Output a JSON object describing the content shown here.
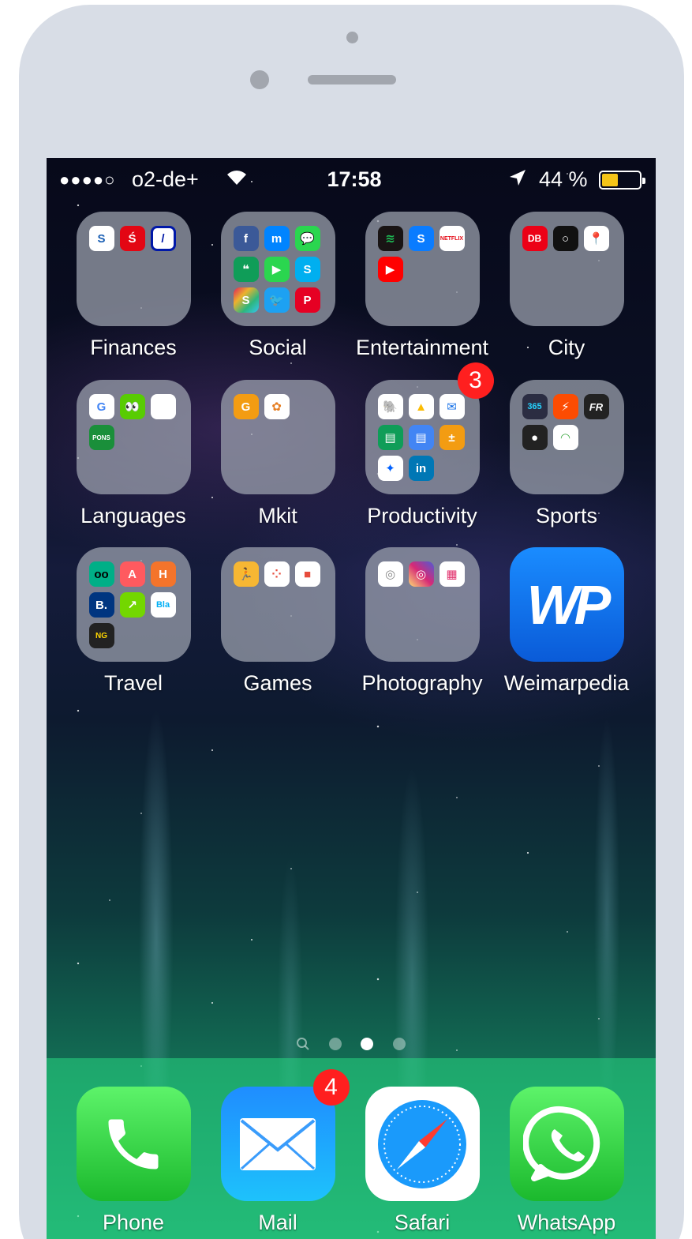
{
  "status_bar": {
    "signal": "●●●●○",
    "carrier": "o2-de+",
    "wifi_icon": "wifi-icon",
    "time": "17:58",
    "location_icon": "location-arrow-icon",
    "battery_percent": "44 %",
    "battery_level": 0.44
  },
  "home": {
    "apps": [
      {
        "label": "Finances",
        "type": "folder"
      },
      {
        "label": "Social",
        "type": "folder"
      },
      {
        "label": "Entertainment",
        "type": "folder"
      },
      {
        "label": "City",
        "type": "folder"
      },
      {
        "label": "Languages",
        "type": "folder"
      },
      {
        "label": "Mkit",
        "type": "folder"
      },
      {
        "label": "Productivity",
        "type": "folder",
        "badge": "3"
      },
      {
        "label": "Sports",
        "type": "folder"
      },
      {
        "label": "Travel",
        "type": "folder"
      },
      {
        "label": "Games",
        "type": "folder"
      },
      {
        "label": "Photography",
        "type": "folder"
      },
      {
        "label": "Weimarpedia",
        "type": "app",
        "icon_text": "WP"
      }
    ],
    "mini_icons": {
      "finances_1": "S",
      "finances_2": "Ś",
      "finances_3": "/",
      "social_1": "f",
      "social_2": "m",
      "social_3": "💬",
      "social_4": "❝",
      "social_5": "▶",
      "social_6": "S",
      "social_7": "S",
      "social_8": "🐦",
      "social_9": "P",
      "ent_1": "≋",
      "ent_2": "S",
      "ent_3": "NETFLIX",
      "ent_4": "▶",
      "city_1": "DB",
      "city_2": "○",
      "city_3": "📍",
      "lang_1": "G",
      "lang_2": "👀",
      "lang_3": "",
      "lang_4": "PONS",
      "mkit_1": "G",
      "mkit_2": "✿",
      "prod_1": "🐘",
      "prod_2": "▲",
      "prod_3": "✉",
      "prod_4": "▤",
      "prod_5": "▤",
      "prod_6": "±",
      "prod_7": "✦",
      "prod_8": "in",
      "sports_1": "365",
      "sports_2": "⚡",
      "sports_3": "FR",
      "sports_4": "●",
      "sports_5": "◠",
      "travel_1": "oo",
      "travel_2": "A",
      "travel_3": "H",
      "travel_4": "B.",
      "travel_5": "↗",
      "travel_6": "Bla",
      "travel_7": "NG",
      "games_1": "🏃",
      "games_2": "⁘",
      "games_3": "■",
      "photo_1": "◎",
      "photo_2": "◎",
      "photo_3": "▦"
    }
  },
  "page_indicator": {
    "search_icon": "search-icon",
    "pages": 3,
    "active_page": 2
  },
  "dock": {
    "apps": [
      {
        "label": "Phone",
        "icon": "phone-icon"
      },
      {
        "label": "Mail",
        "icon": "mail-icon",
        "badge": "4"
      },
      {
        "label": "Safari",
        "icon": "compass-icon"
      },
      {
        "label": "WhatsApp",
        "icon": "whatsapp-icon"
      }
    ]
  },
  "colors": {
    "frame": "#d8dde6",
    "badge": "#ff1f1f",
    "battery_fill": "#f5c518",
    "dock": "#28d782"
  }
}
